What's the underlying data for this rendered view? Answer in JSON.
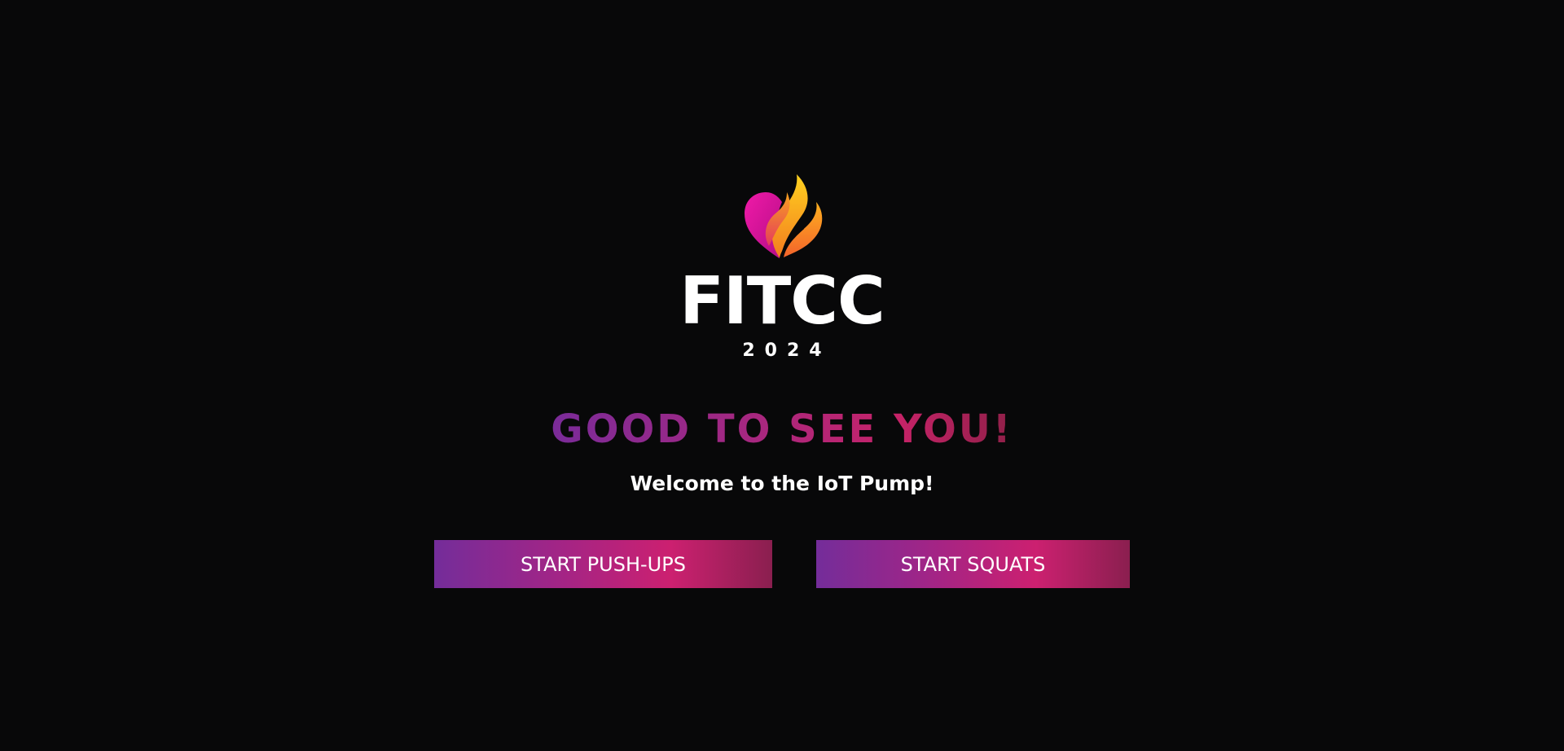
{
  "logo": {
    "icon": "heart-flame-icon",
    "name": "FITCC",
    "year": "2024"
  },
  "greeting": {
    "title": "GOOD TO SEE YOU!",
    "subtitle": "Welcome to the IoT Pump!"
  },
  "actions": {
    "pushups_label": "START PUSH-UPS",
    "squats_label": "START SQUATS"
  },
  "colors": {
    "background": "#080809",
    "gradient_start": "#742d9a",
    "gradient_mid": "#cc2070",
    "gradient_end": "#8a1f4f",
    "flame_yellow": "#f7c21a",
    "flame_orange": "#f6891f",
    "heart_magenta": "#e4129d"
  }
}
